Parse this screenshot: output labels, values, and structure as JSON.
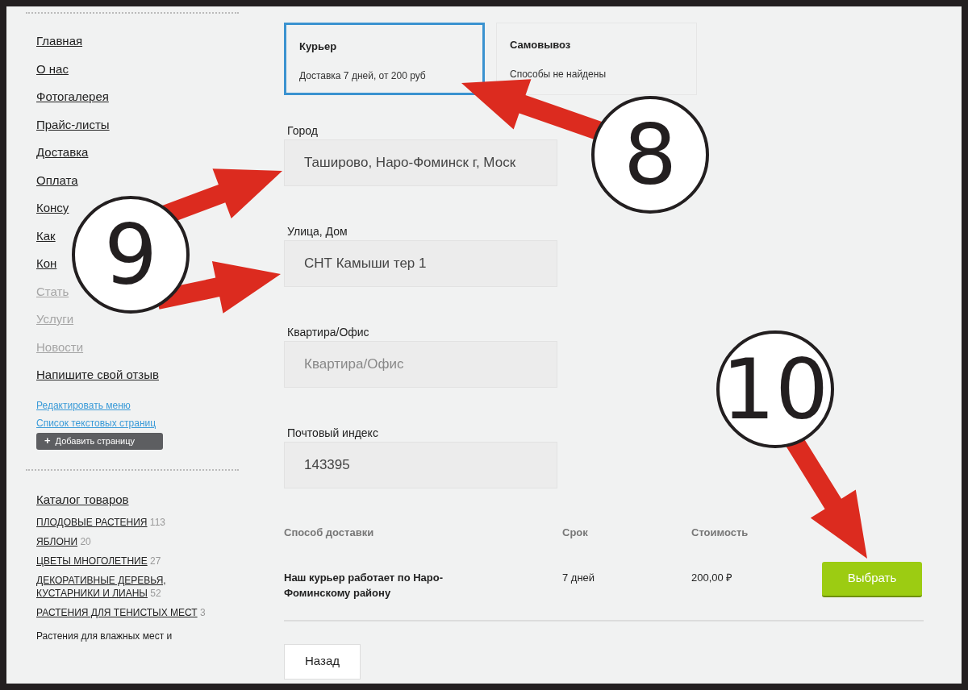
{
  "sidebar": {
    "menu": [
      {
        "label": "Главная",
        "muted": false
      },
      {
        "label": "О нас",
        "muted": false
      },
      {
        "label": "Фотогалерея",
        "muted": false
      },
      {
        "label": "Прайс-листы",
        "muted": false
      },
      {
        "label": "Доставка",
        "muted": false
      },
      {
        "label": "Оплата",
        "muted": false
      },
      {
        "label": "Консу",
        "muted": false
      },
      {
        "label": "Как",
        "muted": false
      },
      {
        "label": "Кон",
        "muted": false
      },
      {
        "label": "Стать",
        "muted": true
      },
      {
        "label": "Услуги",
        "muted": true
      },
      {
        "label": "Новости",
        "muted": true
      },
      {
        "label": "Напишите свой отзыв",
        "muted": false
      }
    ],
    "admin_links": [
      "Редактировать меню",
      "Список текстовых страниц"
    ],
    "add_page_button": {
      "icon": "+",
      "label": "Добавить страницу"
    },
    "catalog_title": "Каталог товаров",
    "catalog": [
      {
        "name": "ПЛОДОВЫЕ РАСТЕНИЯ",
        "count": "113"
      },
      {
        "name": "ЯБЛОНИ",
        "count": "20"
      },
      {
        "name": "ЦВЕТЫ МНОГОЛЕТНИЕ",
        "count": "27"
      },
      {
        "name": "ДЕКОРАТИВНЫЕ ДЕРЕВЬЯ, КУСТАРНИКИ И ЛИАНЫ",
        "count": "52"
      },
      {
        "name": "РАСТЕНИЯ ДЛЯ ТЕНИСТЫХ МЕСТ",
        "count": "3"
      }
    ],
    "catalog_cut_item": "Растения для влажных мест и"
  },
  "delivery_options": [
    {
      "title": "Курьер",
      "subtitle": "Доставка 7 дней, от 200 руб",
      "selected": true
    },
    {
      "title": "Самовывоз",
      "subtitle": "Способы не найдены",
      "selected": false
    }
  ],
  "fields": [
    {
      "label": "Город",
      "value": "Таширово, Наро-Фоминск г, Моск"
    },
    {
      "label": "Улица, Дом",
      "value": "СНТ Камыши тер 1"
    },
    {
      "label": "Квартира/Офис",
      "placeholder": "Квартира/Офис"
    },
    {
      "label": "Почтовый индекс",
      "value": "143395"
    }
  ],
  "table": {
    "columns": [
      "Способ доставки",
      "Срок",
      "Стоимость"
    ],
    "rows": [
      {
        "method": "Наш курьер работает по Наро-Фоминскому району",
        "term": "7 дней",
        "cost": "200,00 ₽",
        "button": "Выбрать"
      }
    ]
  },
  "back_button": "Назад",
  "callouts": [
    {
      "label": "8"
    },
    {
      "label": "9"
    },
    {
      "label": "10"
    }
  ]
}
